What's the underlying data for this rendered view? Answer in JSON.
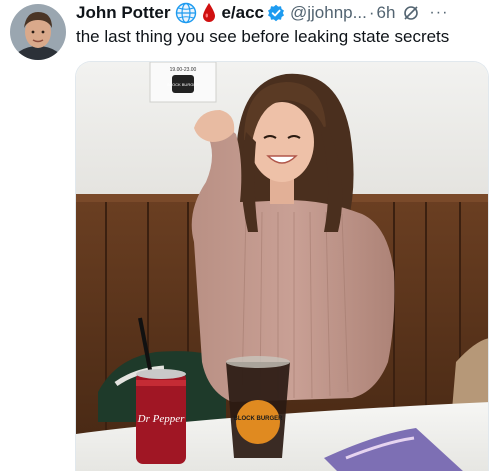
{
  "author": {
    "name": "John Potter",
    "display_name_suffix": "e/acc",
    "handle": "@jjohnp...",
    "separator": "·",
    "time": "6h",
    "more_label": "···"
  },
  "tweet": {
    "text": "the last thing you see before leaking state secrets"
  },
  "photo": {
    "sign_hours": "19.00-23.00",
    "sign_brand": "BLOCK BURGER",
    "cup_brand": "BLOCK BURGER",
    "can_brand": "Dr Pepper"
  },
  "colors": {
    "name": "#0f1419",
    "muted": "#536471",
    "verified": "#1d9bf0",
    "drop": "#d01010"
  },
  "icons": [
    "globe-icon",
    "blood-drop-icon",
    "verified-badge-icon",
    "grok-icon",
    "more-icon"
  ]
}
